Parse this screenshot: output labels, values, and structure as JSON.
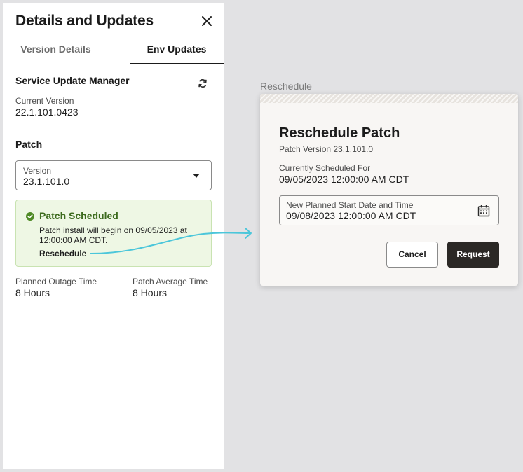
{
  "drawer": {
    "title": "Details and Updates",
    "tabs": [
      {
        "label": "Version Details",
        "active": false
      },
      {
        "label": "Env Updates",
        "active": true
      }
    ],
    "service": {
      "title": "Service Update Manager",
      "current_version_label": "Current Version",
      "current_version_value": "22.1.101.0423"
    },
    "patch": {
      "title": "Patch",
      "version_label": "Version",
      "version_value": "23.1.101.0"
    },
    "status": {
      "title": "Patch Scheduled",
      "message": "Patch install will begin on 09/05/2023 at 12:00:00 AM CDT.",
      "link": "Reschedule"
    },
    "outage": {
      "label": "Planned Outage Time",
      "value": "8 Hours"
    },
    "average": {
      "label": "Patch Average Time",
      "value": "8 Hours"
    }
  },
  "dialog": {
    "caption": "Reschedule",
    "title": "Reschedule Patch",
    "subtitle": "Patch Version 23.1.101.0",
    "current_label": "Currently Scheduled For",
    "current_value": "09/05/2023 12:00:00 AM CDT",
    "input_label": "New Planned Start Date and Time",
    "input_value": "09/08/2023 12:00:00 AM CDT",
    "cancel_label": "Cancel",
    "request_label": "Request"
  },
  "icons": {
    "close": "close-icon",
    "refresh": "refresh-icon",
    "caret": "chevron-down-icon",
    "check": "check-circle-icon",
    "calendar": "calendar-icon",
    "arrow": "arrow-icon"
  },
  "colors": {
    "success_bg": "#eef7e4",
    "success_text": "#3d6b1e",
    "arrow": "#4bc6da",
    "primary_button": "#2b2825"
  }
}
